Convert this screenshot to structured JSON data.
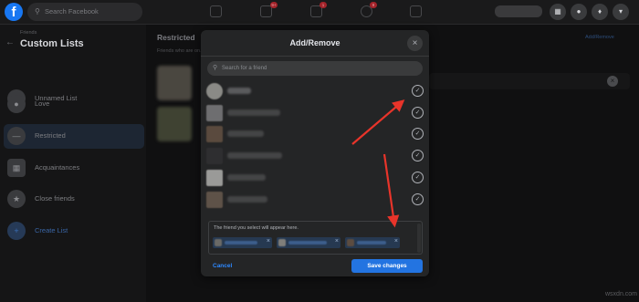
{
  "topbar": {
    "logo": "f",
    "search_placeholder": "Search Facebook",
    "badges": [
      "9+",
      "1",
      "9"
    ],
    "icons": [
      "home-icon",
      "watch-icon",
      "marketplace-icon",
      "groups-icon",
      "gaming-icon",
      "menu-grid-icon",
      "messenger-icon",
      "notifications-icon",
      "account-icon"
    ]
  },
  "sidebar": {
    "breadcrumb": "Friends",
    "title": "Custom Lists",
    "items": [
      {
        "label": "Unnamed List",
        "icon": "person-icon"
      },
      {
        "label": "Love",
        "icon": "person-icon"
      },
      {
        "label": "Restricted",
        "icon": "restricted-icon"
      },
      {
        "label": "Acquaintances",
        "icon": "acquaintances-icon"
      },
      {
        "label": "Close friends",
        "icon": "star-icon"
      },
      {
        "label": "Create List",
        "icon": "plus-icon"
      }
    ]
  },
  "main": {
    "heading": "Restricted",
    "subheading": "Friends who are on...",
    "add_remove_link": "Add/Remove"
  },
  "modal": {
    "title": "Add/Remove",
    "search_placeholder": "Search for a friend",
    "friends": [
      {
        "checked": true
      },
      {
        "checked": true
      },
      {
        "checked": true
      },
      {
        "checked": true
      },
      {
        "checked": true
      },
      {
        "checked": true
      }
    ],
    "selection_hint": "The friend you select will appear here.",
    "chips": [
      {
        "removable": true
      },
      {
        "removable": true
      },
      {
        "removable": true
      }
    ],
    "cancel_label": "Cancel",
    "save_label": "Save changes"
  },
  "colors": {
    "accent": "#2374e1",
    "annotation_arrow": "#e8342a"
  },
  "watermark": "wsxdn.com"
}
